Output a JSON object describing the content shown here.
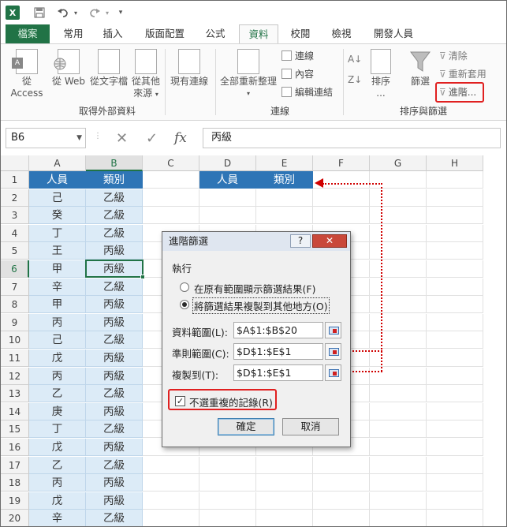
{
  "titlebar": {
    "logo": "X",
    "icons": [
      "save-icon",
      "undo-icon",
      "redo-icon",
      "customize-icon"
    ]
  },
  "tabs": [
    {
      "label": "檔案"
    },
    {
      "label": "常用"
    },
    {
      "label": "插入"
    },
    {
      "label": "版面配置"
    },
    {
      "label": "公式"
    },
    {
      "label": "資料"
    },
    {
      "label": "校閱"
    },
    {
      "label": "檢視"
    },
    {
      "label": "開發人員"
    }
  ],
  "ribbon": {
    "external": {
      "access": "從 Access",
      "web": "從 Web",
      "text": "從文字檔",
      "other_line1": "從其他",
      "other_line2": "來源",
      "existing": "現有連線",
      "group": "取得外部資料"
    },
    "connections": {
      "refresh": "全部重新整理",
      "conn": "連線",
      "props": "內容",
      "edit": "編輯連結",
      "group": "連線"
    },
    "sort": {
      "sort": "排序",
      "sort_sub": "...",
      "filter": "篩選",
      "clear": "清除",
      "reapply": "重新套用",
      "advanced": "進階...",
      "group": "排序與篩選"
    }
  },
  "formula_bar": {
    "name_box": "B6",
    "cancel": "✕",
    "enter": "✓",
    "fx": "fx",
    "value": "丙級"
  },
  "grid": {
    "columns": [
      "A",
      "B",
      "C",
      "D",
      "E",
      "F",
      "G",
      "H"
    ],
    "rows": [
      "1",
      "2",
      "3",
      "4",
      "5",
      "6",
      "7",
      "8",
      "9",
      "10",
      "11",
      "12",
      "13",
      "14",
      "15",
      "16",
      "17",
      "18",
      "19",
      "20"
    ],
    "header_ab": [
      "人員",
      "類別"
    ],
    "header_de": [
      "人員",
      "類別"
    ],
    "data": [
      [
        "己",
        "乙級"
      ],
      [
        "癸",
        "乙級"
      ],
      [
        "丁",
        "乙級"
      ],
      [
        "王",
        "丙級"
      ],
      [
        "甲",
        "丙級"
      ],
      [
        "辛",
        "乙級"
      ],
      [
        "甲",
        "丙級"
      ],
      [
        "丙",
        "丙級"
      ],
      [
        "己",
        "乙級"
      ],
      [
        "戊",
        "丙級"
      ],
      [
        "丙",
        "丙級"
      ],
      [
        "乙",
        "乙級"
      ],
      [
        "庚",
        "丙級"
      ],
      [
        "丁",
        "乙級"
      ],
      [
        "戊",
        "丙級"
      ],
      [
        "乙",
        "乙級"
      ],
      [
        "丙",
        "丙級"
      ],
      [
        "戊",
        "丙級"
      ],
      [
        "辛",
        "乙級"
      ]
    ]
  },
  "dialog": {
    "title": "進階篩選",
    "help": "?",
    "close": "✕",
    "section": "執行",
    "opt1": "在原有範圍顯示篩選結果(F)",
    "opt2": "將篩選結果複製到其他地方(O)",
    "list_label": "資料範圍(L):",
    "list_value": "$A$1:$B$20",
    "criteria_label": "準則範圍(C):",
    "criteria_value": "$D$1:$E$1",
    "copy_label": "複製到(T):",
    "copy_value": "$D$1:$E$1",
    "unique": "不選重複的記錄(R)",
    "ok": "確定",
    "cancel": "取消"
  }
}
